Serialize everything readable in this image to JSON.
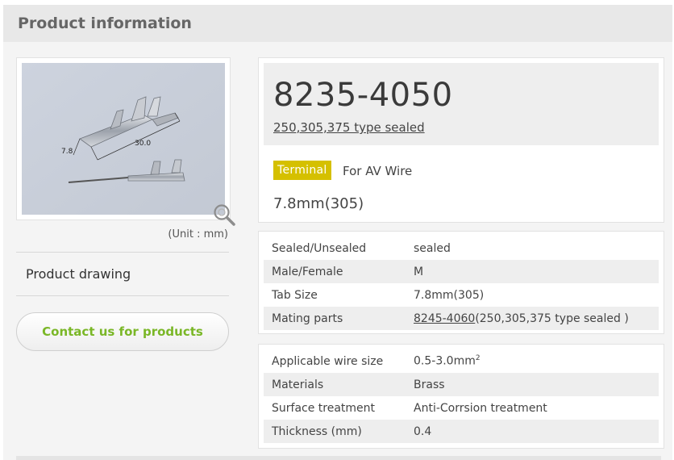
{
  "header": {
    "title": "Product information"
  },
  "left": {
    "unit_note": "(Unit : mm)",
    "drawing_link": "Product drawing",
    "contact_button": "Contact us for products",
    "image_dims": {
      "d1": "7.8",
      "d2": "30.0"
    }
  },
  "product": {
    "part_number": "8235-4050",
    "series_link": "250,305,375 type sealed",
    "tag": "Terminal",
    "tag_color": "#d5c000",
    "category": "For AV Wire",
    "size": "7.8mm(305)"
  },
  "specs1": [
    {
      "label": "Sealed/Unsealed",
      "value": "sealed"
    },
    {
      "label": "Male/Female",
      "value": "M"
    },
    {
      "label": "Tab Size",
      "value": "7.8mm(305)"
    },
    {
      "label": "Mating parts",
      "link": "8245-4060",
      "suffix": "(250,305,375 type sealed )"
    }
  ],
  "specs2": [
    {
      "label": "Applicable wire size",
      "value": "0.5-3.0mm",
      "sup": "2"
    },
    {
      "label": "Materials",
      "value": "Brass"
    },
    {
      "label": "Surface treatment",
      "value": "Anti-Corrsion treatment"
    },
    {
      "label": "Thickness (mm)",
      "value": "0.4"
    }
  ],
  "colors": {
    "accent_green": "#7ab727",
    "header_bg": "#e8e8e8"
  }
}
